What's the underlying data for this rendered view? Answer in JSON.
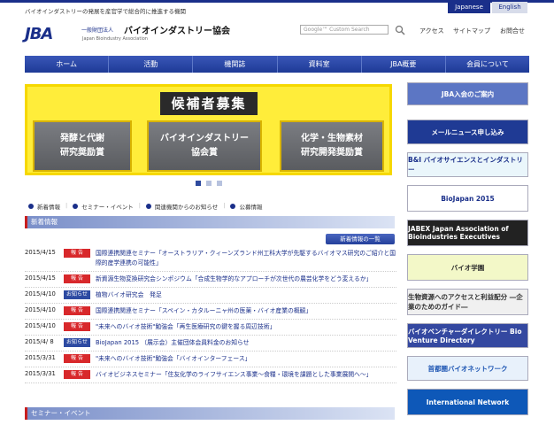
{
  "header": {
    "tagline": "バイオインダストリーの発展を産官学で総合的に推進する機関",
    "lang_jp": "Japanese",
    "lang_en": "English",
    "logo": "JBA",
    "org_prefix": "一般財団法人",
    "org_name": "バイオインダストリー協会",
    "org_name_en": "Japan Bioindustry Association",
    "search_placeholder": "Google™ Custom Search",
    "util": [
      "アクセス",
      "サイトマップ",
      "お問合せ"
    ]
  },
  "nav": [
    "ホーム",
    "活動",
    "機関誌",
    "資料室",
    "JBA概要",
    "会員について"
  ],
  "banner": {
    "title": "候補者募集",
    "awards": [
      "発酵と代謝\n研究奨励賞",
      "バイオインダストリー\n協会賞",
      "化学・生物素材\n研究開発奨励賞"
    ]
  },
  "anchors": [
    "新着情報",
    "セミナー・イベント",
    "関連機関からのお知らせ",
    "公募情報"
  ],
  "news": {
    "heading": "新着情報",
    "more": "新着情報の一覧",
    "items": [
      {
        "date": "2015/4/15",
        "badge": "報 告",
        "badge_type": "red",
        "text": "国際連携関連セミナー「オーストラリア・クィーンズランド州工科大学が先駆するバイオマス研究のご紹介と国際的産学連携の可能性」"
      },
      {
        "date": "2015/4/15",
        "badge": "報 告",
        "badge_type": "red",
        "text": "新資源生物変換研究会シンポジウム「合成生物学的なアプローチが次世代の農芸化学をどう変えるか」"
      },
      {
        "date": "2015/4/10",
        "badge": "お知らせ",
        "badge_type": "blue",
        "text": "植物バイオ研究会　発足"
      },
      {
        "date": "2015/4/10",
        "badge": "報 告",
        "badge_type": "red",
        "text": "国際連携関連セミナー「スペイン・カタルーニャ州の医薬・バイオ産業の概観」"
      },
      {
        "date": "2015/4/10",
        "badge": "報 告",
        "badge_type": "red",
        "text": "\"未来へのバイオ技術\"勉強会「再生医療研究の鍵を握る周辺技術」"
      },
      {
        "date": "2015/4/ 8",
        "badge": "お知らせ",
        "badge_type": "blue",
        "text": "BioJapan 2015 （展示会）主催団体会員料金のお知らせ"
      },
      {
        "date": "2015/3/31",
        "badge": "報 告",
        "badge_type": "red",
        "text": "\"未来へのバイオ技術\"勉強会「バイオインターフェース」"
      },
      {
        "date": "2015/3/31",
        "badge": "報 告",
        "badge_type": "red",
        "text": "バイオビジネスセミナー「住友化学のライフサイエンス事業～食糧・環境を課題とした事業展開へ～」"
      }
    ]
  },
  "seminar_heading": "セミナー・イベント",
  "sidebar": [
    {
      "label": "JBA入会のご案内",
      "bg": "#5c76c4",
      "color": "#ffffff"
    },
    {
      "label": "メールニュース申し込み",
      "bg": "#1f3a94",
      "color": "#ffffff"
    },
    {
      "label": "B&I  バイオサイエンスとインダストリー",
      "bg": "#eaf6fb",
      "color": "#1a2f8a"
    },
    {
      "label": "BioJapan 2015",
      "bg": "#ffffff",
      "color": "#1a2f8a"
    },
    {
      "label": "JABEX  Japan Association of Bioindustries Executives",
      "bg": "#222222",
      "color": "#ffffff"
    },
    {
      "label": "バイオ学園",
      "bg": "#f3f8c8",
      "color": "#2d2d2d"
    },
    {
      "label": "生物資源へのアクセスと利益配分 ―企業のためのガイド―",
      "bg": "#f0f0f0",
      "color": "#333333"
    },
    {
      "label": "バイオベンチャーダイレクトリー  Bio Venture Directory",
      "bg": "#3448a0",
      "color": "#ffffff"
    },
    {
      "label": "首都圏バイオネットワーク",
      "bg": "#e8f1fb",
      "color": "#1e56b3"
    },
    {
      "label": "International Network",
      "bg": "#0e58b8",
      "color": "#ffffff"
    }
  ]
}
